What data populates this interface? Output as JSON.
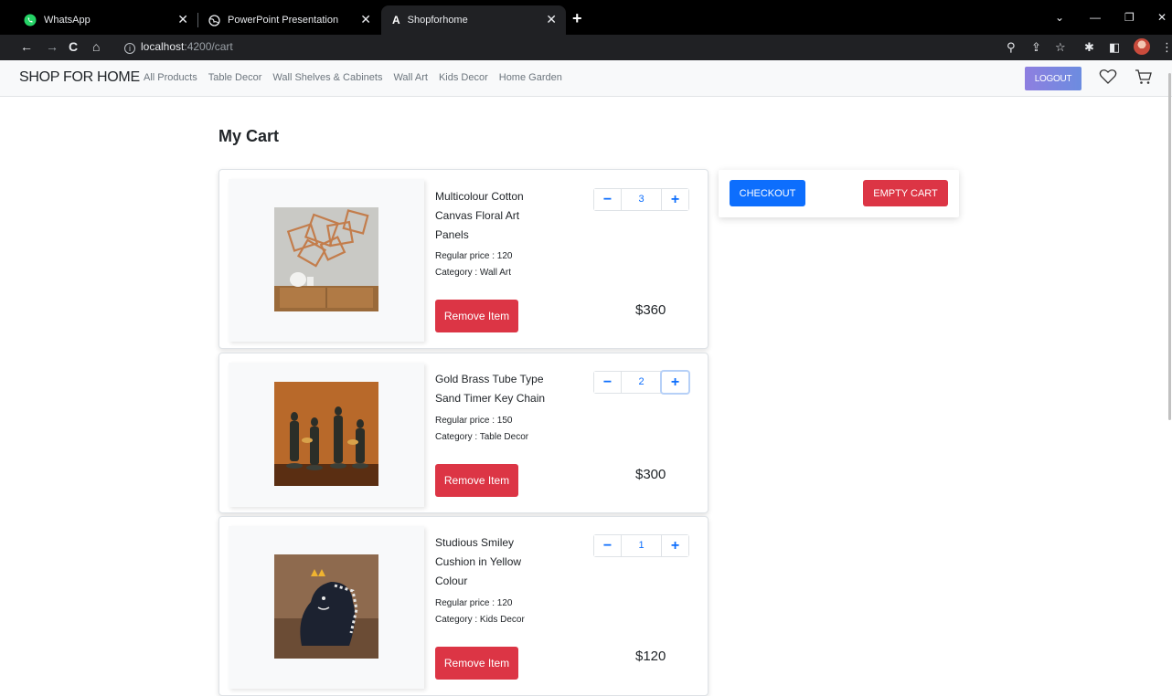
{
  "browser": {
    "tabs": [
      {
        "title": "WhatsApp"
      },
      {
        "title": "PowerPoint Presentation"
      },
      {
        "title": "Shopforhome"
      }
    ],
    "url_host": "localhost",
    "url_path": ":4200/cart"
  },
  "navbar": {
    "brand": "SHOP FOR HOME",
    "links": [
      "All Products",
      "Table Decor",
      "Wall Shelves & Cabinets",
      "Wall Art",
      "Kids Decor",
      "Home Garden"
    ],
    "logout_label": "LOGOUT"
  },
  "page": {
    "title": "My Cart"
  },
  "cart": {
    "items": [
      {
        "name": "Multicolour Cotton Canvas Floral Art Panels",
        "regular_price": "Regular price : 120",
        "category": "Category : Wall Art",
        "quantity": "3",
        "remove_label": "Remove Item",
        "total": "$360"
      },
      {
        "name": "Gold Brass Tube Type Sand Timer Key Chain",
        "regular_price": "Regular price : 150",
        "category": "Category : Table Decor",
        "quantity": "2",
        "remove_label": "Remove Item",
        "total": "$300"
      },
      {
        "name": "Studious Smiley Cushion in Yellow Colour",
        "regular_price": "Regular price : 120",
        "category": "Category : Kids Decor",
        "quantity": "1",
        "remove_label": "Remove Item",
        "total": "$120"
      }
    ],
    "checkout_label": "CHECKOUT",
    "empty_label": "EMPTY CART"
  },
  "colors": {
    "primary": "#0d6efd",
    "danger": "#dc3545",
    "logout_gradient_start": "#8e7fe0",
    "logout_gradient_end": "#6c8ce0"
  }
}
